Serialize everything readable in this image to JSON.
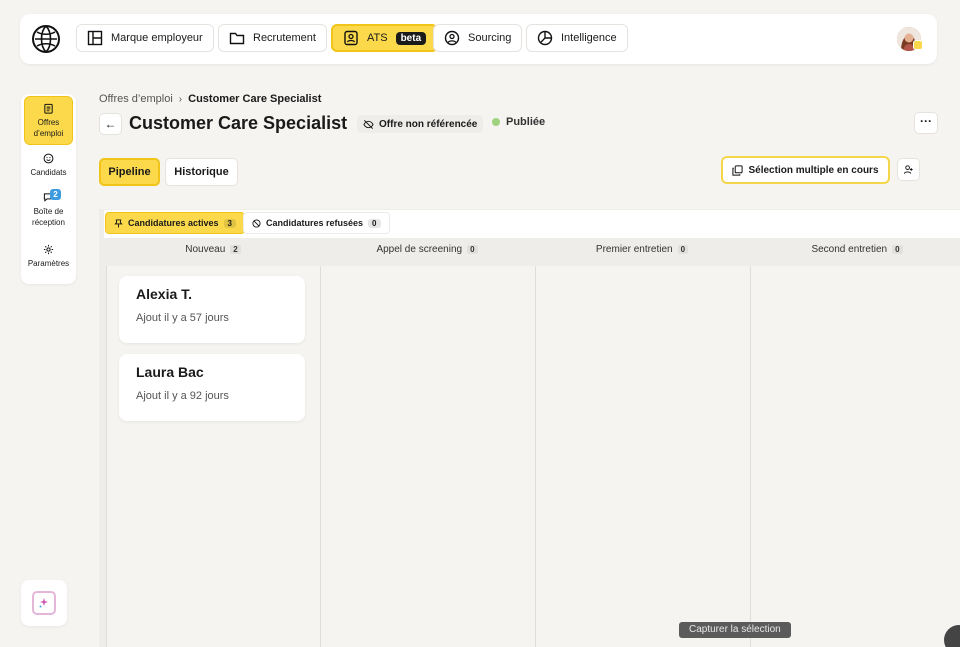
{
  "nav": {
    "items": [
      {
        "label": "Marque employeur",
        "icon": "layout-icon"
      },
      {
        "label": "Recrutement",
        "icon": "folder-icon"
      },
      {
        "label": "ATS",
        "icon": "badge-icon",
        "badge": "beta",
        "active": true
      },
      {
        "label": "Sourcing",
        "icon": "user-circle-icon"
      },
      {
        "label": "Intelligence",
        "icon": "pie-chart-icon"
      }
    ]
  },
  "sidebar": {
    "items": [
      {
        "label": "Offres d’emploi",
        "icon": "clipboard-icon",
        "active": true
      },
      {
        "label": "Candidats",
        "icon": "smile-icon"
      },
      {
        "label": "Boîte de réception",
        "icon": "chat-icon",
        "badge": "2"
      },
      {
        "label": "Paramètres",
        "icon": "gear-icon"
      }
    ]
  },
  "breadcrumb": {
    "parent": "Offres d’emploi",
    "current": "Customer Care Specialist"
  },
  "job": {
    "title": "Customer Care Specialist",
    "visibility": "Offre non référencée",
    "status": "Publiée",
    "status_color": "#9ed27f"
  },
  "tabs": {
    "pipeline": "Pipeline",
    "history": "Historique"
  },
  "actions": {
    "multi_select": "Sélection multiple en cours"
  },
  "filters": {
    "active_label": "Candidatures actives",
    "active_count": "3",
    "refused_label": "Candidatures refusées",
    "refused_count": "0"
  },
  "columns": [
    {
      "title": "Nouveau",
      "count": "2"
    },
    {
      "title": "Appel de screening",
      "count": "0"
    },
    {
      "title": "Premier entretien",
      "count": "0"
    },
    {
      "title": "Second entretien",
      "count": "0"
    }
  ],
  "candidates": [
    {
      "name": "Alexia T.",
      "added": "Ajout il y a 57 jours"
    },
    {
      "name": "Laura Bac",
      "added": "Ajout il y a 92 jours"
    }
  ],
  "tooltip": "Capturer la sélection",
  "colors": {
    "accent": "#fbd94b",
    "accent_border": "#f0c419",
    "info": "#3d9be0"
  }
}
